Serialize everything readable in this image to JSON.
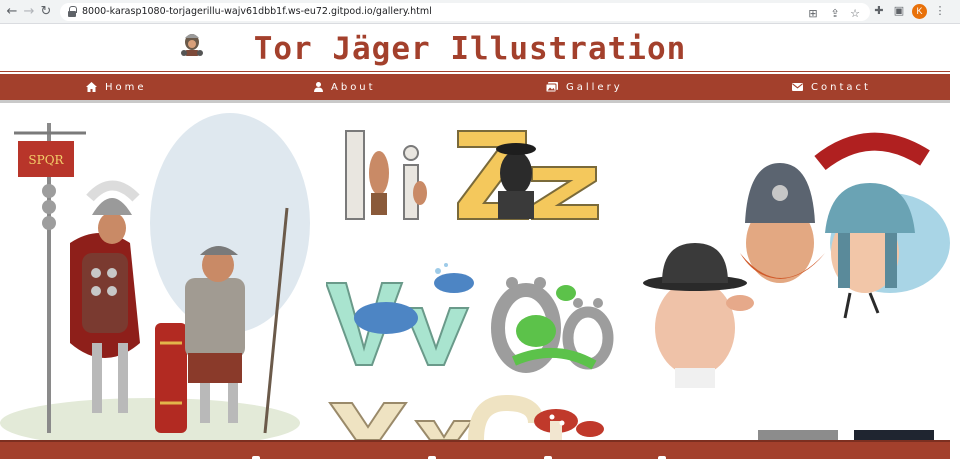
{
  "browser": {
    "url": "8000-karasp1080-torjagerillu-wajv61dbb1f.ws-eu72.gitpod.io/gallery.html",
    "profile_initial": "K",
    "icons": [
      "back-arrow-icon",
      "forward-arrow-icon",
      "reload-icon",
      "translate-icon",
      "share-icon",
      "star-icon",
      "extensions-icon",
      "sidebar-icon",
      "menu-dots-icon"
    ]
  },
  "site": {
    "title": "Tor Jäger Illustration",
    "brand_color": "#a3402c"
  },
  "nav": {
    "items": [
      {
        "label": "Home",
        "icon": "home-icon"
      },
      {
        "label": "About",
        "icon": "person-icon"
      },
      {
        "label": "Gallery",
        "icon": "images-icon"
      },
      {
        "label": "Contact",
        "icon": "envelope-icon"
      }
    ]
  },
  "gallery": {
    "banner_text": "SPQR",
    "letter_pairs": [
      "Ii",
      "Zz",
      "Vv",
      "Öö",
      "Xx",
      "Ss"
    ]
  }
}
